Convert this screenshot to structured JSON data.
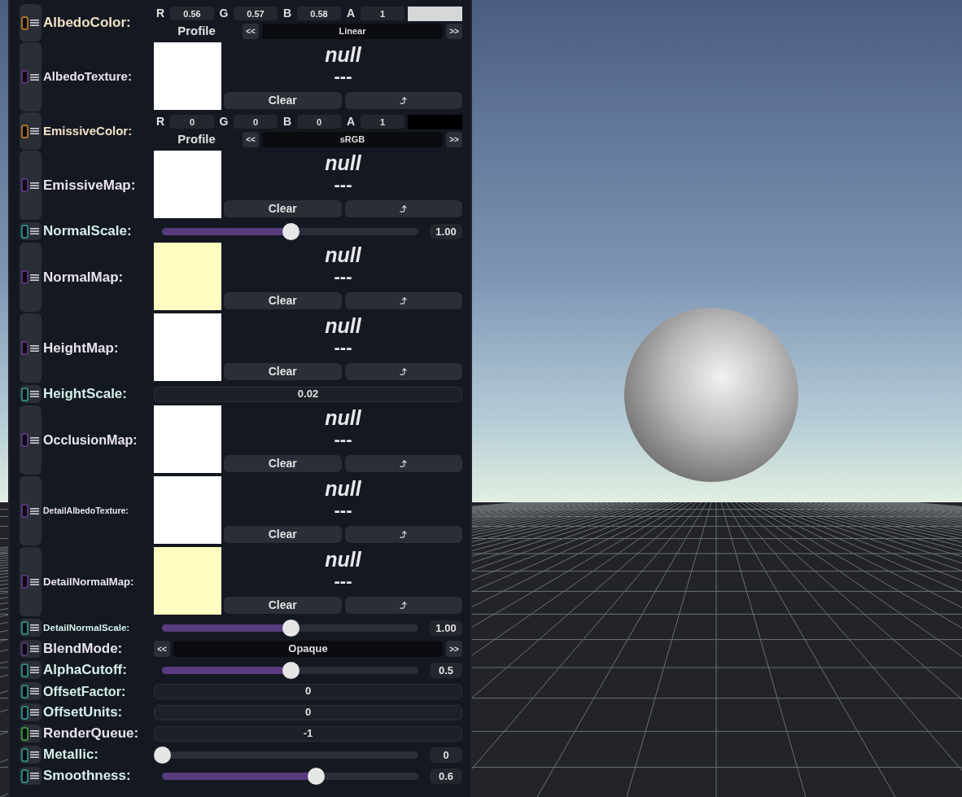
{
  "properties": [
    {
      "kind": "color",
      "label": "AlbedoColor:",
      "channels": [
        {
          "label": "R",
          "value": "0.56"
        },
        {
          "label": "G",
          "value": "0.57"
        },
        {
          "label": "B",
          "value": "0.58"
        },
        {
          "label": "A",
          "value": "1"
        }
      ],
      "color": "#d6d7d8",
      "profile_label": "Profile",
      "prev": "<<",
      "profile": "Linear",
      "next": ">>"
    },
    {
      "kind": "texture",
      "label": "AlbedoTexture:",
      "color": "#ffffff",
      "value": "null",
      "path": "---",
      "clear": "Clear"
    },
    {
      "kind": "color",
      "label": "EmissiveColor:",
      "channels": [
        {
          "label": "R",
          "value": "0"
        },
        {
          "label": "G",
          "value": "0"
        },
        {
          "label": "B",
          "value": "0"
        },
        {
          "label": "A",
          "value": "1"
        }
      ],
      "color": "#000000",
      "profile_label": "Profile",
      "prev": "<<",
      "profile": "sRGB",
      "next": ">>"
    },
    {
      "kind": "texture",
      "label": "EmissiveMap:",
      "color": "#ffffff",
      "value": "null",
      "path": "---",
      "clear": "Clear"
    },
    {
      "kind": "slider",
      "label": "NormalScale:",
      "level": 0.5,
      "reading": "1.00"
    },
    {
      "kind": "texture",
      "label": "NormalMap:",
      "color": "#fffdc0",
      "value": "null",
      "path": "---",
      "clear": "Clear"
    },
    {
      "kind": "texture",
      "label": "HeightMap:",
      "color": "#ffffff",
      "value": "null",
      "path": "---",
      "clear": "Clear"
    },
    {
      "kind": "float",
      "label": "HeightScale:",
      "value": "0.02"
    },
    {
      "kind": "texture",
      "label": "OcclusionMap:",
      "color": "#ffffff",
      "value": "null",
      "path": "---",
      "clear": "Clear"
    },
    {
      "kind": "texture",
      "label": "DetailAlbedoTexture:",
      "color": "#ffffff",
      "value": "null",
      "path": "---",
      "clear": "Clear"
    },
    {
      "kind": "texture",
      "label": "DetailNormalMap:",
      "color": "#fffdc0",
      "value": "null",
      "path": "---",
      "clear": "Clear"
    },
    {
      "kind": "slider",
      "label": "DetailNormalScale:",
      "level": 0.5,
      "reading": "1.00"
    },
    {
      "kind": "enum",
      "label": "BlendMode:",
      "prev": "<<",
      "value": "Opaque",
      "next": ">>"
    },
    {
      "kind": "slider",
      "label": "AlphaCutoff:",
      "level": 0.5,
      "reading": "0.5"
    },
    {
      "kind": "float",
      "label": "OffsetFactor:",
      "value": "0"
    },
    {
      "kind": "float",
      "label": "OffsetUnits:",
      "value": "0"
    },
    {
      "kind": "int",
      "label": "RenderQueue:",
      "value": "-1"
    },
    {
      "kind": "slider",
      "label": "Metallic:",
      "level": 0,
      "reading": "0"
    },
    {
      "kind": "slider",
      "label": "Smoothness:",
      "level": 0.6,
      "reading": "0.6"
    }
  ]
}
